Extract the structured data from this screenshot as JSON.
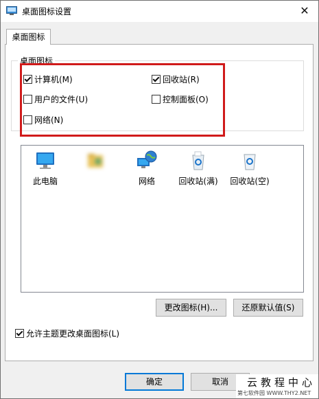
{
  "window": {
    "title": "桌面图标设置",
    "close_symbol": "✕"
  },
  "tab": {
    "label": "桌面图标"
  },
  "group": {
    "title": "桌面图标"
  },
  "checkboxes": [
    {
      "label": "计算机(M)",
      "checked": true
    },
    {
      "label": "回收站(R)",
      "checked": true
    },
    {
      "label": "用户的文件(U)",
      "checked": false
    },
    {
      "label": "控制面板(O)",
      "checked": false
    },
    {
      "label": "网络(N)",
      "checked": false
    }
  ],
  "icons": [
    {
      "label": "此电脑",
      "icon": "monitor-icon"
    },
    {
      "label": "",
      "icon": "user-folder-icon"
    },
    {
      "label": "网络",
      "icon": "network-globe-icon"
    },
    {
      "label": "回收站(满)",
      "icon": "recycle-bin-full-icon"
    },
    {
      "label": "回收站(空)",
      "icon": "recycle-bin-empty-icon"
    }
  ],
  "buttons": {
    "change_icon": "更改图标(H)...",
    "restore_default": "还原默认值(S)",
    "ok": "确定",
    "cancel": "取消"
  },
  "allow_themes": {
    "label": "允许主题更改桌面图标(L)",
    "checked": true
  },
  "watermark": {
    "big": "云教程中心",
    "small": "第七软件园 WWW.THY2.NET"
  },
  "colors": {
    "highlight": "#d01a1a",
    "accent": "#0078d7"
  }
}
